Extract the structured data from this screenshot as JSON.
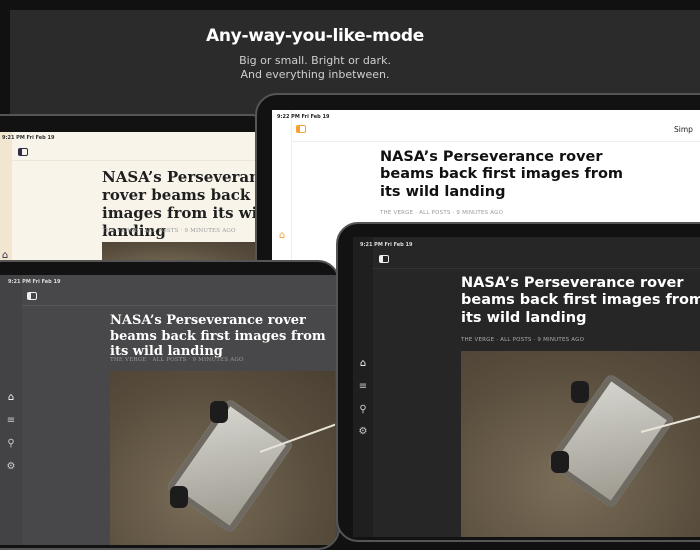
{
  "hero": {
    "title": "Any-way-you-like-mode",
    "subtitle_line1": "Big or small. Bright or dark.",
    "subtitle_line2": "And everything inbetween."
  },
  "article": {
    "headline": "NASA’s Perseverance rover beams back first images from its wild landing",
    "meta": "THE VERGE · ALL POSTS · 9 MINUTES AGO"
  },
  "devices": [
    {
      "theme": "sepia",
      "status": "9:21 PM   Fri Feb 19"
    },
    {
      "theme": "light",
      "status": "9:22 PM   Fri Feb 19",
      "toolbar_right": "Simp"
    },
    {
      "theme": "gray",
      "status": "9:21 PM   Fri Feb 19"
    },
    {
      "theme": "dark",
      "status": "9:21 PM   Fri Feb 19"
    }
  ],
  "nav_icons": [
    "home-icon",
    "list-icon",
    "search-icon",
    "gear-icon"
  ],
  "colors": {
    "accent_orange": "#f7a035",
    "sepia_bg": "#f8f4ea",
    "dark_bg": "#262626",
    "gray_bg": "#48484a"
  }
}
